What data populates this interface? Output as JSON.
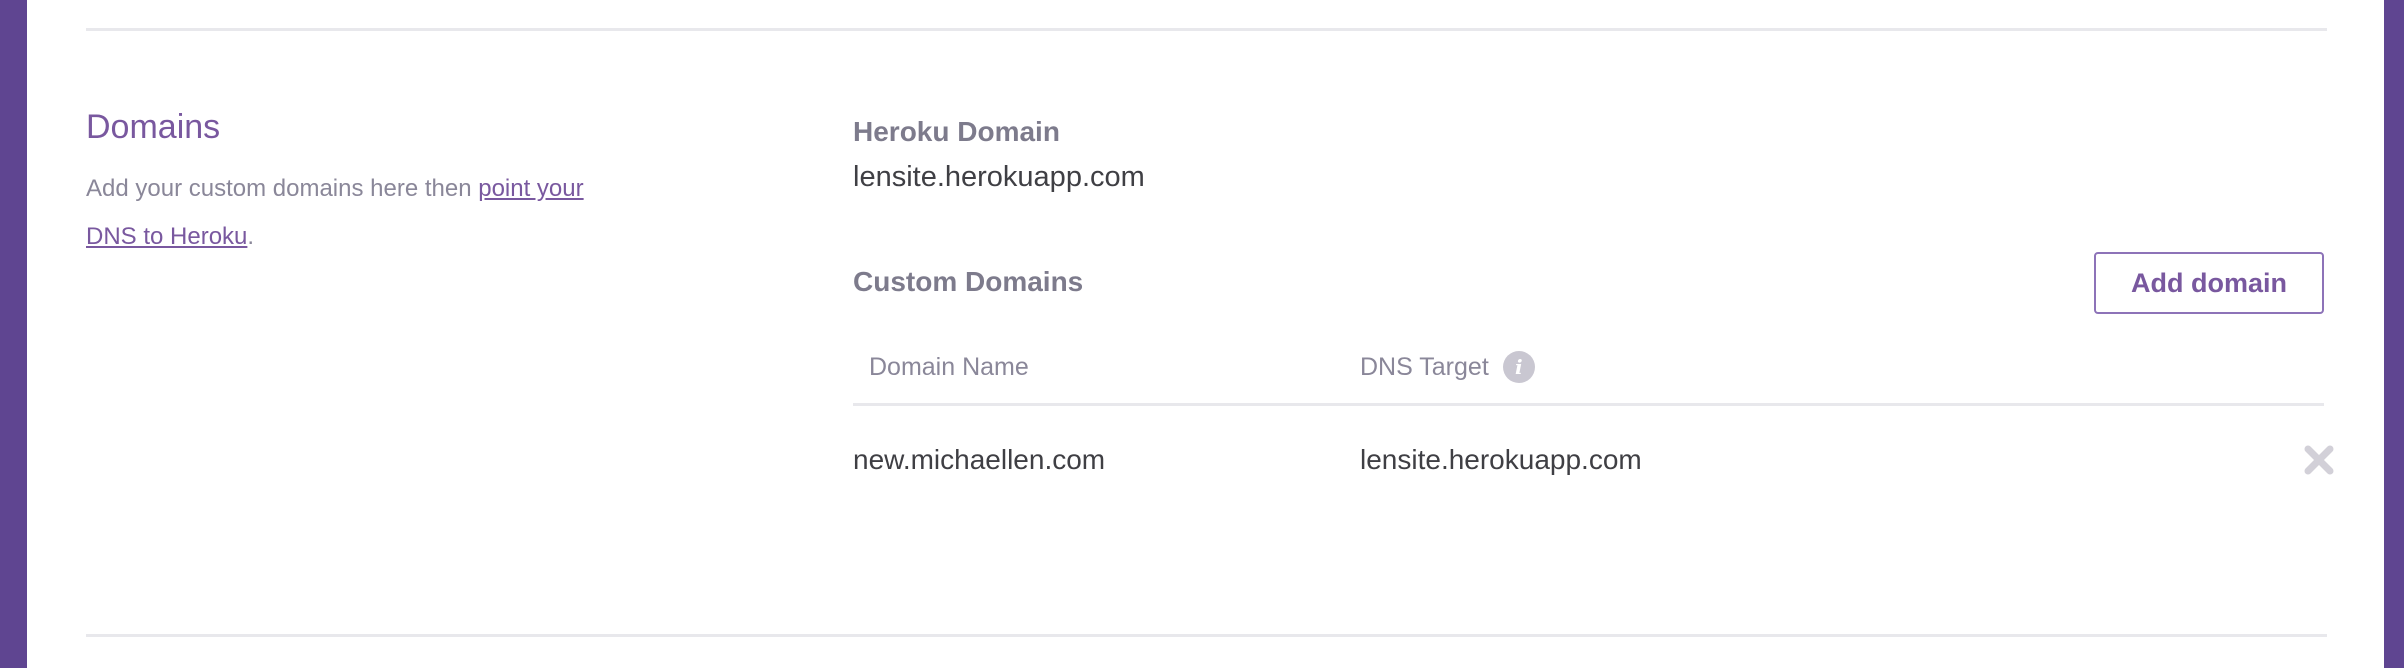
{
  "domains_section": {
    "title": "Domains",
    "description_prefix": "Add your custom domains here then ",
    "link_text": "point your DNS to Heroku",
    "description_suffix": "."
  },
  "heroku_domain": {
    "label": "Heroku Domain",
    "value": "lensite.herokuapp.com"
  },
  "custom_domains": {
    "label": "Custom Domains",
    "add_button_label": "Add domain",
    "columns": {
      "domain_name": "Domain Name",
      "dns_target": "DNS Target"
    },
    "info_icon": "info-icon",
    "rows": [
      {
        "domain_name": "new.michaellen.com",
        "dns_target": "lensite.herokuapp.com",
        "remove_icon": "close-icon"
      }
    ]
  },
  "colors": {
    "accent": "#79589f",
    "sidebar_background": "#5f4591",
    "muted_text": "#8a8799",
    "body_text": "#3f3f44",
    "divider": "#e8e8ec",
    "icon_gray": "#c9c7d1"
  }
}
